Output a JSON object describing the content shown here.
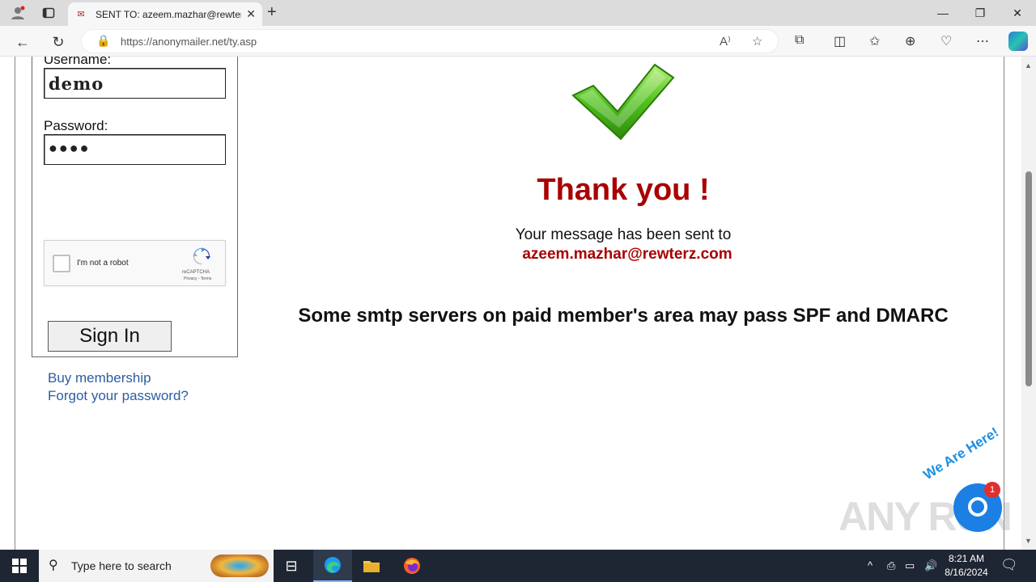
{
  "browser": {
    "tab_title": "SENT TO: azeem.mazhar@rewterz",
    "url": "https://anonymailer.net/ty.asp"
  },
  "login": {
    "username_label": "Username:",
    "username_value": "demo",
    "password_label": "Password:",
    "password_mask": "●●●●",
    "recaptcha_label": "I'm not a robot",
    "recaptcha_brand": "reCAPTCHA",
    "recaptcha_terms": "Privacy - Terms",
    "signin_label": "Sign In",
    "buy_membership": "Buy membership",
    "forgot_password": "Forgot your password?"
  },
  "confirmation": {
    "title": "Thank you !",
    "message": "Your message has been sent to",
    "recipient": "azeem.mazhar@rewterz.com",
    "note": "Some smtp servers on paid member's area may pass SPF and DMARC"
  },
  "overlay": {
    "watermark": "ANY RUN",
    "chat_tagline": "We Are Here!",
    "chat_badge": "1"
  },
  "taskbar": {
    "search_placeholder": "Type here to search",
    "time": "8:21 AM",
    "date": "8/16/2024"
  },
  "colors": {
    "accent_red": "#a80000",
    "link_blue": "#2d5da0",
    "check_green": "#3cb01a"
  }
}
